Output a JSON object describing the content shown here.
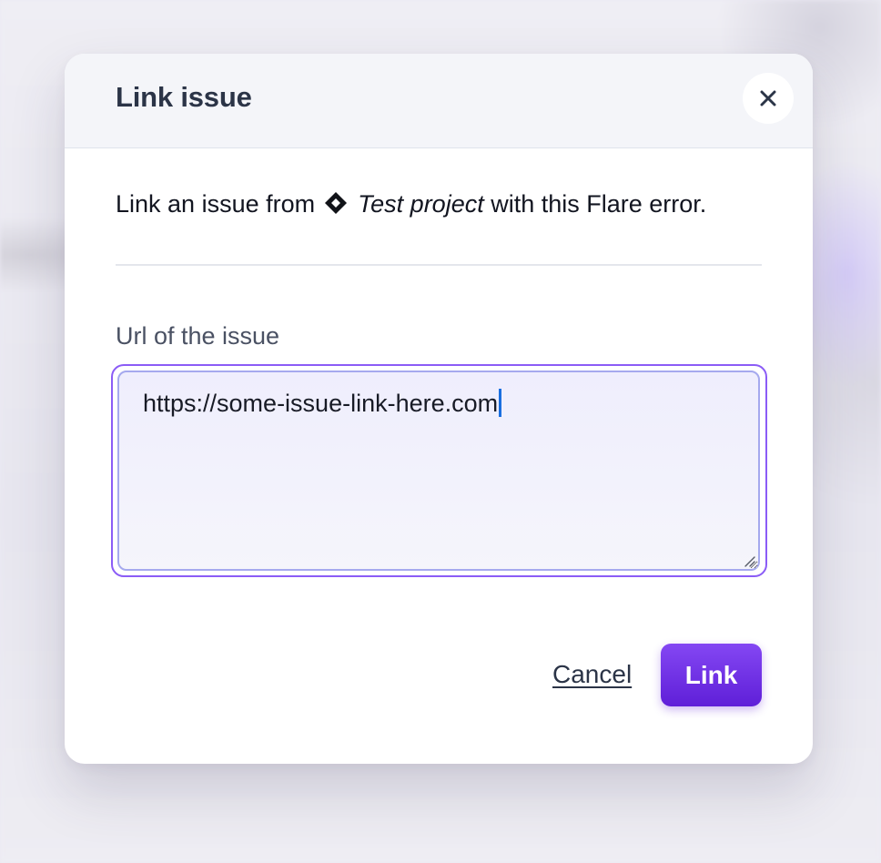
{
  "modal": {
    "title": "Link issue",
    "close_icon": "close-icon"
  },
  "intro": {
    "prefix": "Link an issue from",
    "project_icon": "diamond-icon",
    "project_name": "Test project",
    "suffix": "with this Flare error."
  },
  "form": {
    "url_label": "Url of the issue",
    "url_value": "https://some-issue-link-here.com",
    "textarea_state": "focused"
  },
  "actions": {
    "cancel_label": "Cancel",
    "link_label": "Link"
  },
  "colors": {
    "accent": "#7c3aed",
    "focus_ring": "#8b5cf6",
    "caret": "#1a6fe0",
    "title_text": "#2b3447"
  }
}
